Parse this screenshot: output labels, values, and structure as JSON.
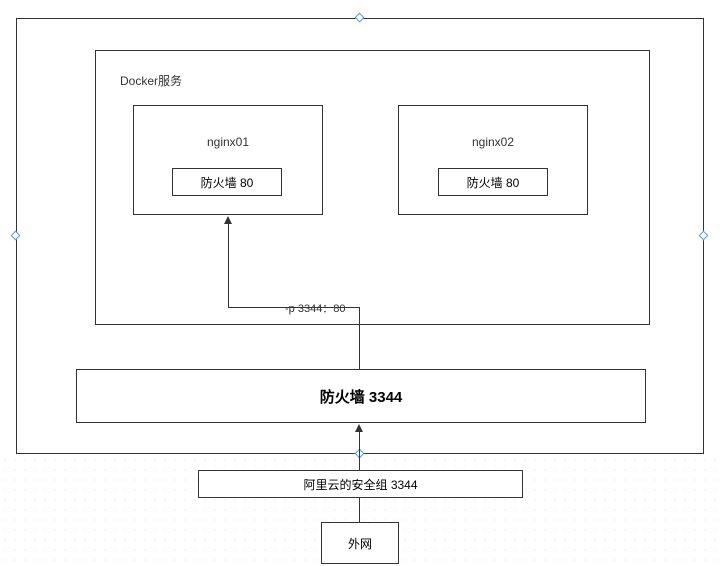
{
  "outer": {},
  "docker": {
    "title": "Docker服务"
  },
  "containers": [
    {
      "name": "nginx01",
      "firewall": "防火墙  80"
    },
    {
      "name": "nginx02",
      "firewall": "防火墙  80"
    }
  ],
  "port_mapping_label": "-p 3344：80",
  "host_firewall": "防火墙   3344",
  "security_group": "阿里云的安全组   3344",
  "internet": "外网"
}
